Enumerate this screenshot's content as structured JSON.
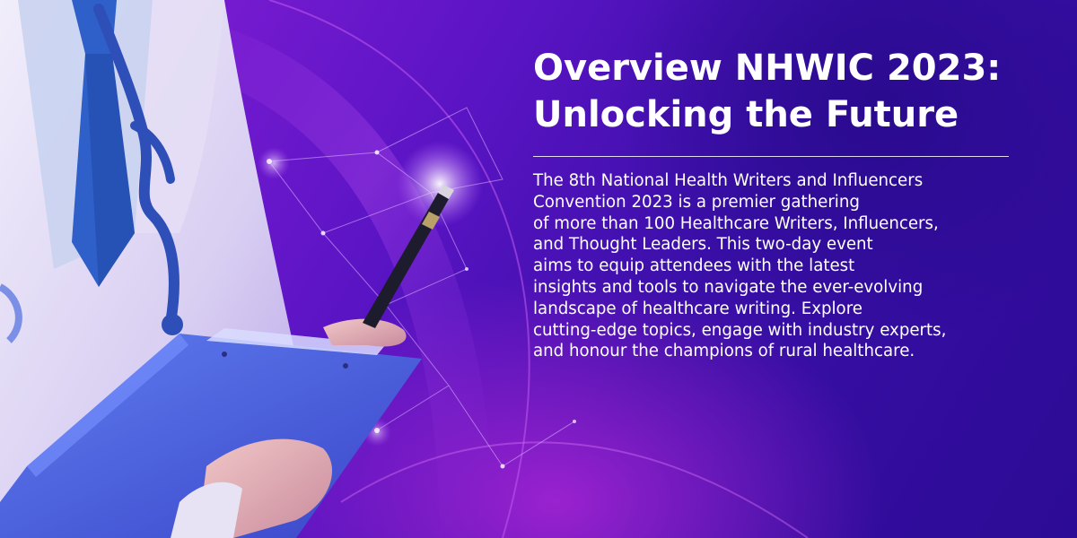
{
  "headline": {
    "lines": [
      "Overview NHWIC 2023:",
      "Unlocking the Future"
    ]
  },
  "description": {
    "lines": [
      "The 8th National Health Writers and Influencers",
      "Convention 2023 is a premier gathering",
      "of more than 100 Healthcare Writers, Influencers,",
      "and Thought Leaders. This two-day event",
      "aims to equip attendees with the latest",
      "insights and tools to navigate the ever-evolving",
      "landscape of healthcare writing. Explore",
      "cutting-edge topics, engage with industry experts,",
      "and honour the champions of rural healthcare."
    ]
  },
  "colors": {
    "background_deep": "#2c0b95",
    "background_magenta": "#8a1fd8",
    "clipboard_blue": "#4a5fe0",
    "coat_white": "#e9e4f6",
    "tie_blue": "#2f5fc8",
    "text": "#ffffff"
  },
  "illustration": {
    "subject": "doctor-holding-clipboard-and-pen",
    "icons": [
      "stethoscope-icon",
      "pen-icon",
      "clipboard-icon",
      "network-lines-icon"
    ]
  }
}
